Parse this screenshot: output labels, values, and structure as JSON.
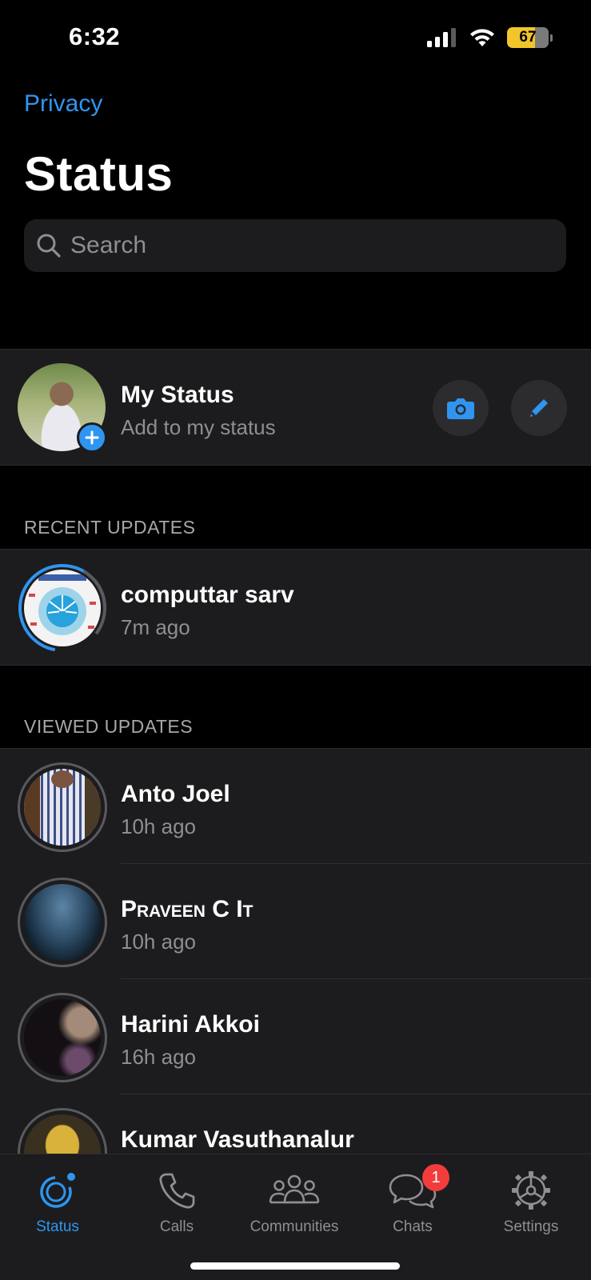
{
  "status_bar": {
    "time": "6:32",
    "battery": "67"
  },
  "header": {
    "back_label": "Privacy",
    "title": "Status"
  },
  "search": {
    "placeholder": "Search"
  },
  "my_status": {
    "name": "My Status",
    "subtitle": "Add to my status"
  },
  "recent": {
    "label": "RECENT UPDATES",
    "items": [
      {
        "name": "computtar sarv",
        "time": "7m ago"
      }
    ]
  },
  "viewed": {
    "label": "VIEWED UPDATES",
    "items": [
      {
        "name": "Anto Joel",
        "time": "10h ago"
      },
      {
        "name": "Praveen C It",
        "time": "10h ago"
      },
      {
        "name": "Harini Akkoi",
        "time": "16h ago"
      },
      {
        "name": "Kumar Vasuthanalur",
        "time": ""
      }
    ]
  },
  "tabs": [
    {
      "label": "Status",
      "icon": "status-icon",
      "active": true
    },
    {
      "label": "Calls",
      "icon": "phone-icon"
    },
    {
      "label": "Communities",
      "icon": "communities-icon"
    },
    {
      "label": "Chats",
      "icon": "chat-bubble-icon",
      "badge": "1"
    },
    {
      "label": "Settings",
      "icon": "gear-icon"
    }
  ],
  "colors": {
    "accent": "#2f95f0",
    "badge": "#f23c3c",
    "battery": "#f2c52b"
  }
}
